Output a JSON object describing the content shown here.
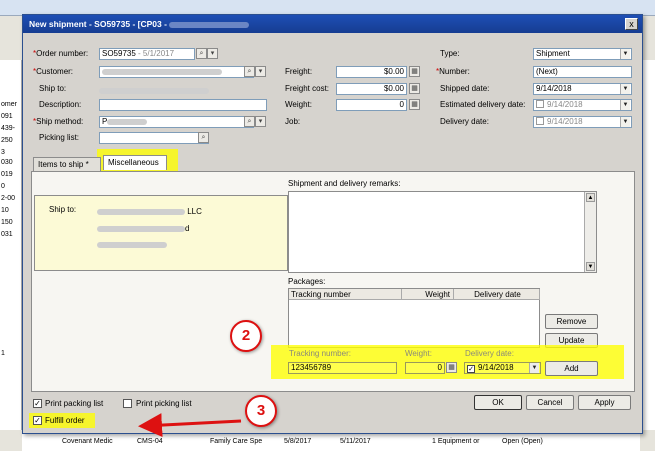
{
  "dialog": {
    "title": "New shipment - SO59735 - [CP03 - ",
    "close_glyph": "x"
  },
  "form": {
    "order_number_label": "Order number:",
    "order_number_value": "SO59735",
    "order_number_date": "- 5/1/2017",
    "customer_label": "Customer:",
    "ship_to_label": "Ship to:",
    "description_label": "Description:",
    "ship_method_label": "Ship method:",
    "ship_method_prefix": "P",
    "picking_list_label": "Picking list:",
    "freight_label": "Freight:",
    "freight_value": "$0.00",
    "freight_cost_label": "Freight cost:",
    "freight_cost_value": "$0.00",
    "weight_label": "Weight:",
    "weight_value": "0",
    "job_label": "Job:",
    "type_label": "Type:",
    "type_value": "Shipment",
    "number_label": "Number:",
    "number_value": "(Next)",
    "shipped_date_label": "Shipped date:",
    "shipped_date_value": "9/14/2018",
    "est_delivery_label": "Estimated delivery date:",
    "est_delivery_value": "9/14/2018",
    "delivery_date_label": "Delivery date:",
    "delivery_date_value": "9/14/2018"
  },
  "tabs": [
    {
      "label": "Items to ship *"
    },
    {
      "label": "Miscellaneous"
    }
  ],
  "misc": {
    "ship_to_label": "Ship to:",
    "ship_to_line1_tail": "LLC",
    "ship_to_line2_tail": "d",
    "remarks_label": "Shipment and delivery remarks:",
    "packages_label": "Packages:",
    "columns": [
      "Tracking number",
      "Weight",
      "Delivery date"
    ],
    "remove_label": "Remove",
    "update_label": "Update",
    "tracking_number_label": "Tracking number:",
    "tracking_number_value": "123456789",
    "weight_label": "Weight:",
    "weight_value": "0",
    "delivery_date_label": "Delivery date:",
    "delivery_date_value": "9/14/2018",
    "add_label": "Add"
  },
  "footer": {
    "print_packing_list_1": "Print packing list",
    "print_picking_list": "Print picking list",
    "fulfill_order": "Fulfill order",
    "ok_label": "OK",
    "cancel_label": "Cancel",
    "apply_label": "Apply"
  },
  "callouts": [
    "2",
    "3"
  ],
  "background": {
    "left_cells": [
      "omer",
      "091",
      "439-",
      "250",
      "3",
      "030",
      "019",
      "0",
      "2-00",
      "10",
      "150",
      "031",
      "1"
    ],
    "bottom_row": [
      "Covenant Medic",
      "CMS-04",
      "Family Care Spe",
      "5/8/2017",
      "5/11/2017",
      "1 Equipment or",
      "Open (Open)"
    ]
  },
  "colors": {
    "highlight": "#ffff00",
    "callout_red": "#dd1111",
    "titlebar": "#1e4fb5",
    "ship_to_bg": "#fcfad6"
  }
}
